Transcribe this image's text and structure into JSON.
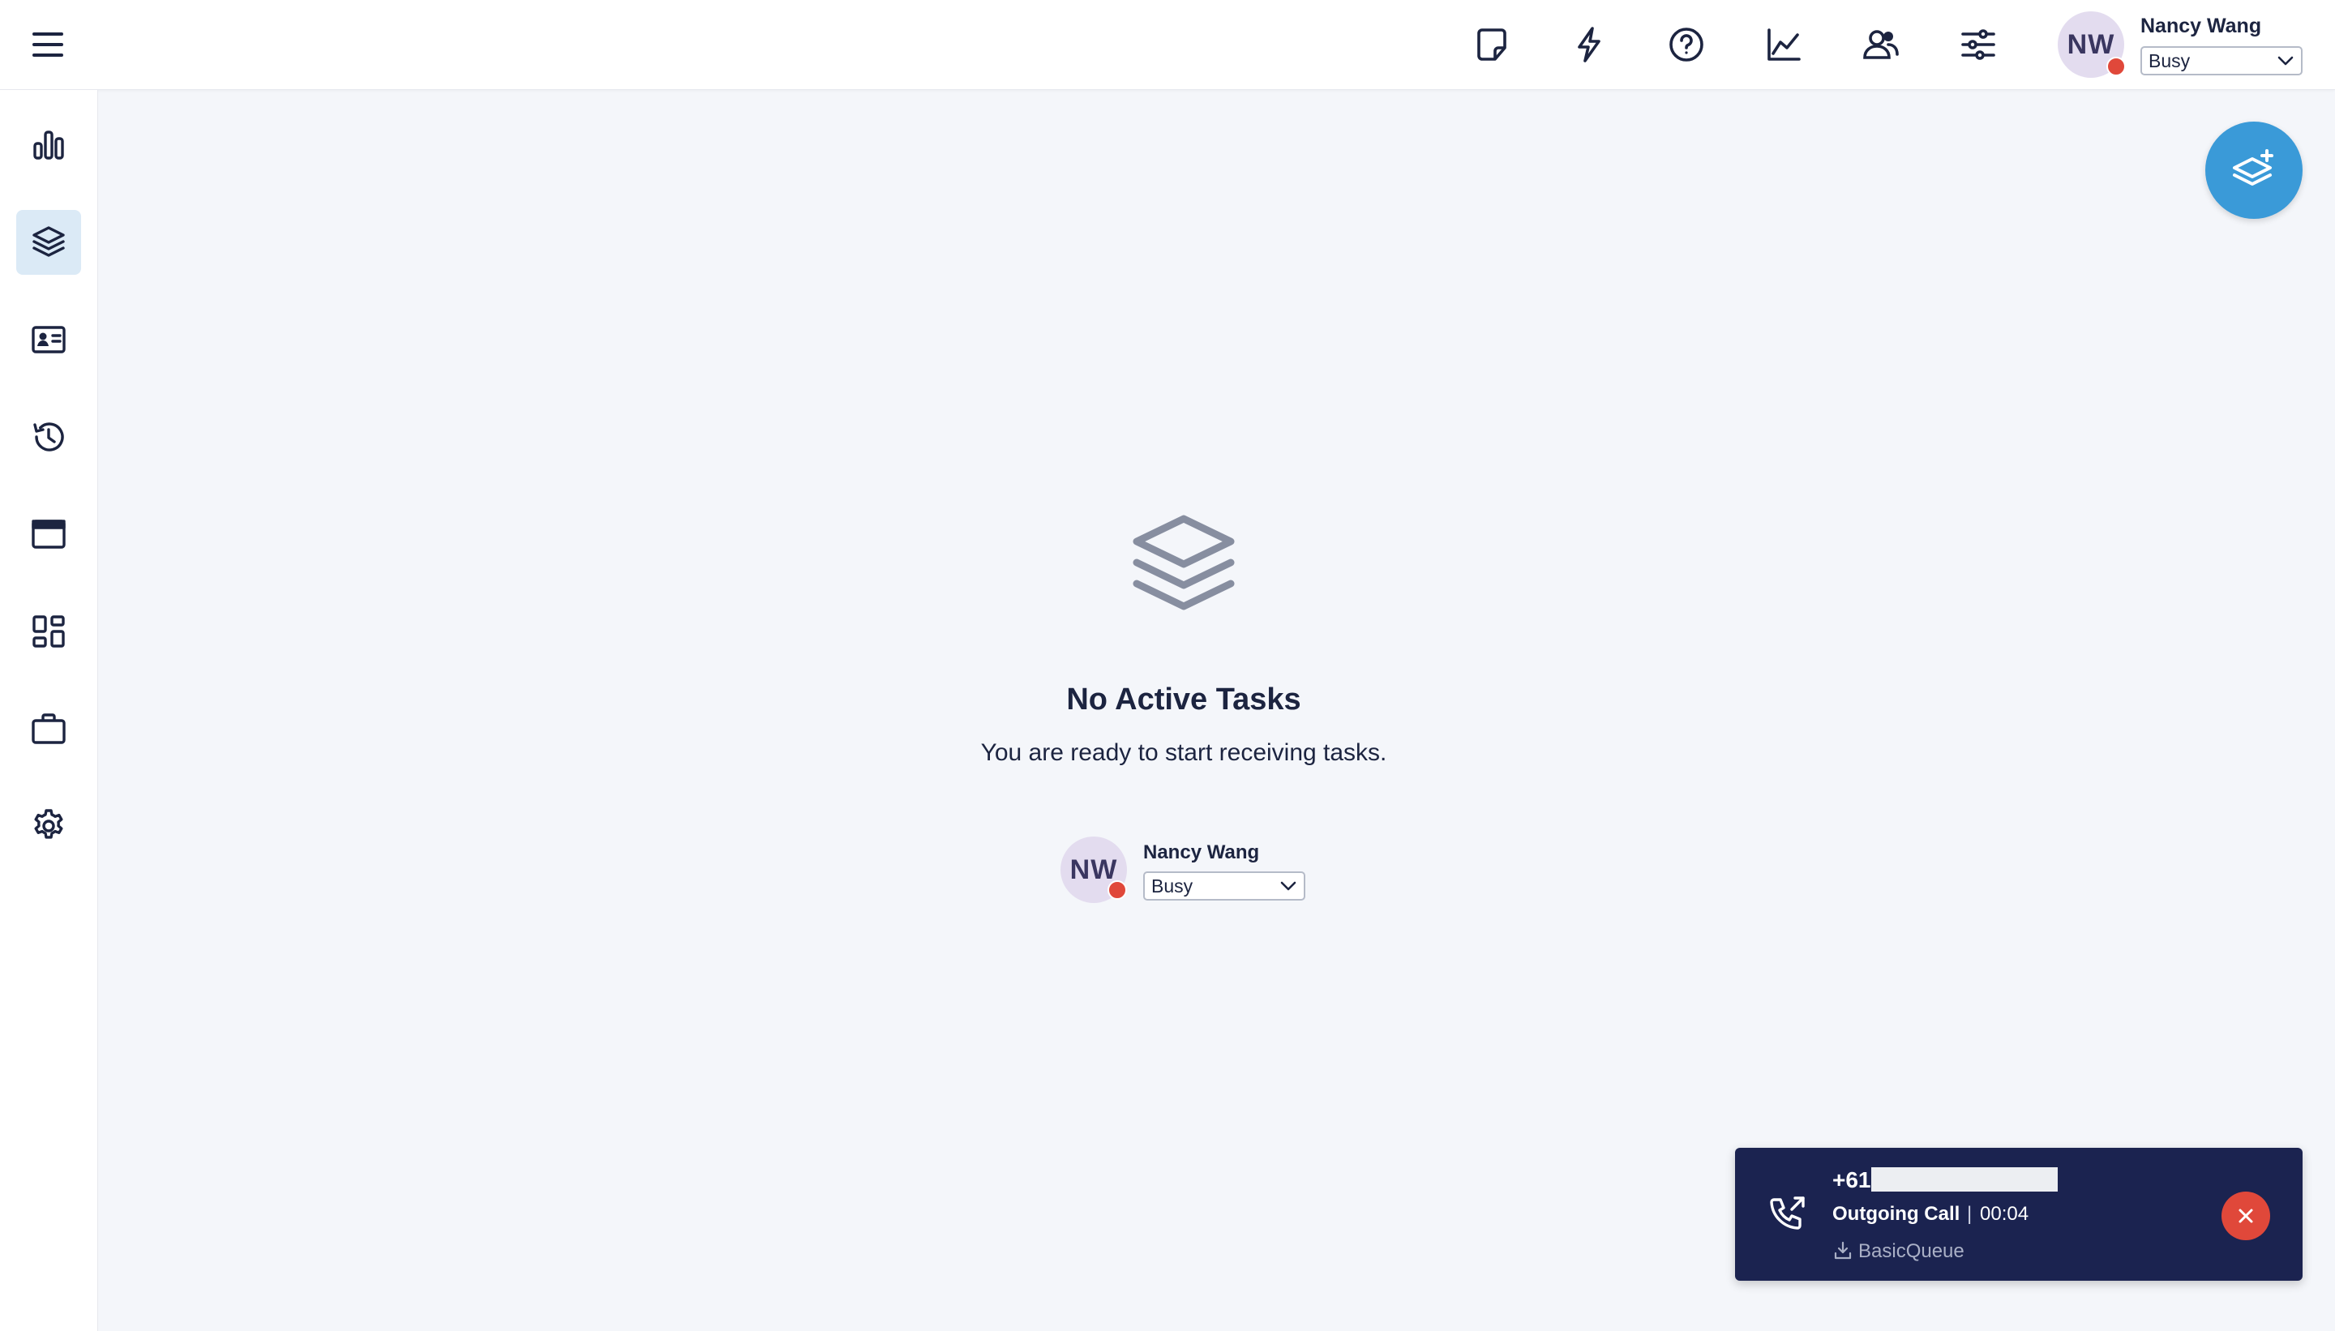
{
  "header": {
    "user": {
      "initials": "NW",
      "name": "Nancy Wang",
      "status": "Busy"
    },
    "icons": [
      "note-icon",
      "bolt-icon",
      "help-icon",
      "chart-line-icon",
      "users-icon",
      "sliders-icon"
    ]
  },
  "sidebar": {
    "items": [
      {
        "icon": "bar-chart-icon",
        "active": false
      },
      {
        "icon": "layers-icon",
        "active": true
      },
      {
        "icon": "contact-card-icon",
        "active": false
      },
      {
        "icon": "history-icon",
        "active": false
      },
      {
        "icon": "browser-window-icon",
        "active": false
      },
      {
        "icon": "dashboard-icon",
        "active": false
      },
      {
        "icon": "briefcase-icon",
        "active": false
      },
      {
        "icon": "settings-icon",
        "active": false
      }
    ]
  },
  "main": {
    "empty_title": "No Active Tasks",
    "empty_subtitle": "You are ready to start receiving tasks.",
    "user": {
      "initials": "NW",
      "name": "Nancy Wang",
      "status": "Busy"
    }
  },
  "call": {
    "number_prefix": "+61",
    "type": "Outgoing Call",
    "separator": "|",
    "timer": "00:04",
    "queue": "BasicQueue"
  },
  "colors": {
    "accent": "#3a9ad8",
    "sidebar_active": "#dbeaf6",
    "status_busy": "#e0483a",
    "call_card": "#1b2350",
    "icon": "#1c2440",
    "empty_icon": "#878ea0"
  }
}
